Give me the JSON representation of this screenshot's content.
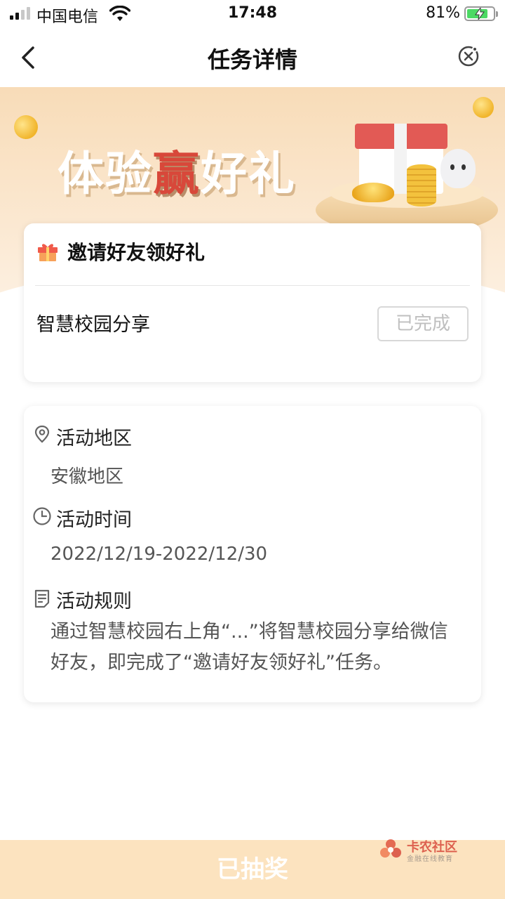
{
  "status_bar": {
    "carrier": "中国电信",
    "time": "17:48",
    "battery_percent": "81%",
    "battery_level": 0.81,
    "icons": [
      "signal-icon",
      "wifi-icon",
      "battery-charging-icon"
    ]
  },
  "nav": {
    "title": "任务详情",
    "back_icon": "chevron-left-icon",
    "close_icon": "close-circle-icon"
  },
  "banner": {
    "title_part1": "体验",
    "title_accent": "赢",
    "title_part2": "好礼"
  },
  "task_card": {
    "icon": "gift-icon",
    "heading": "邀请好友领好礼",
    "task_name": "智慧校园分享",
    "status_label": "已完成"
  },
  "info_card": {
    "region_label": "活动地区",
    "region_value": "安徽地区",
    "time_label": "活动时间",
    "time_value": "2022/12/19-2022/12/30",
    "rules_label": "活动规则",
    "rules_text": "通过智慧校园右上角“...”将智慧校园分享给微信好友，即完成了“邀请好友领好礼”任务。"
  },
  "bottom": {
    "button_label": "已抽奖"
  },
  "watermark": {
    "title": "卡农社区",
    "subtitle": "金融在线教育"
  },
  "colors": {
    "accent_red": "#d8483a",
    "bottom_bar": "#fce3bf",
    "banner_bg": "#f8dcb8"
  }
}
